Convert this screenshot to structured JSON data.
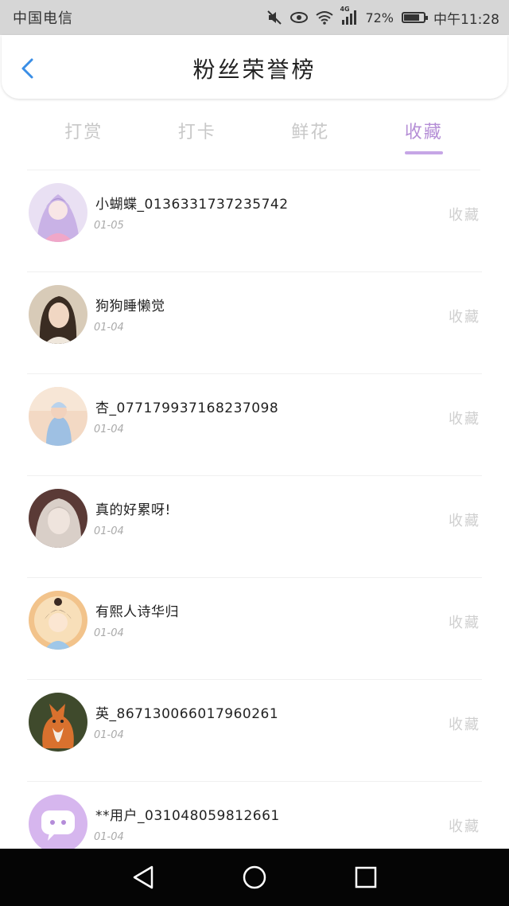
{
  "status_bar": {
    "carrier": "中国电信",
    "network": "4G",
    "battery": "72%",
    "battery_level": 0.72,
    "time": "中午11:28"
  },
  "header": {
    "title": "粉丝荣誉榜",
    "back_icon": "chevron-left-icon",
    "accent_color": "#3a8ee6"
  },
  "tabs": [
    {
      "label": "打赏",
      "active": false
    },
    {
      "label": "打卡",
      "active": false
    },
    {
      "label": "鲜花",
      "active": false
    },
    {
      "label": "收藏",
      "active": true
    }
  ],
  "tab_active_color": "#b58ed6",
  "items": [
    {
      "name": "小蝴蝶_0136331737235742",
      "date": "01-05",
      "action": "收藏"
    },
    {
      "name": "狗狗睡懒觉",
      "date": "01-04",
      "action": "收藏"
    },
    {
      "name": "杏_077179937168237098",
      "date": "01-04",
      "action": "收藏"
    },
    {
      "name": "真的好累呀!",
      "date": "01-04",
      "action": "收藏"
    },
    {
      "name": "有熙人诗华归",
      "date": "01-04",
      "action": "收藏"
    },
    {
      "name": "英_867130066017960261",
      "date": "01-04",
      "action": "收藏"
    },
    {
      "name": "**用户_031048059812661",
      "date": "01-04",
      "action": "收藏"
    }
  ],
  "nav": {
    "back": "triangle-back-icon",
    "home": "circle-home-icon",
    "recents": "square-recents-icon"
  }
}
